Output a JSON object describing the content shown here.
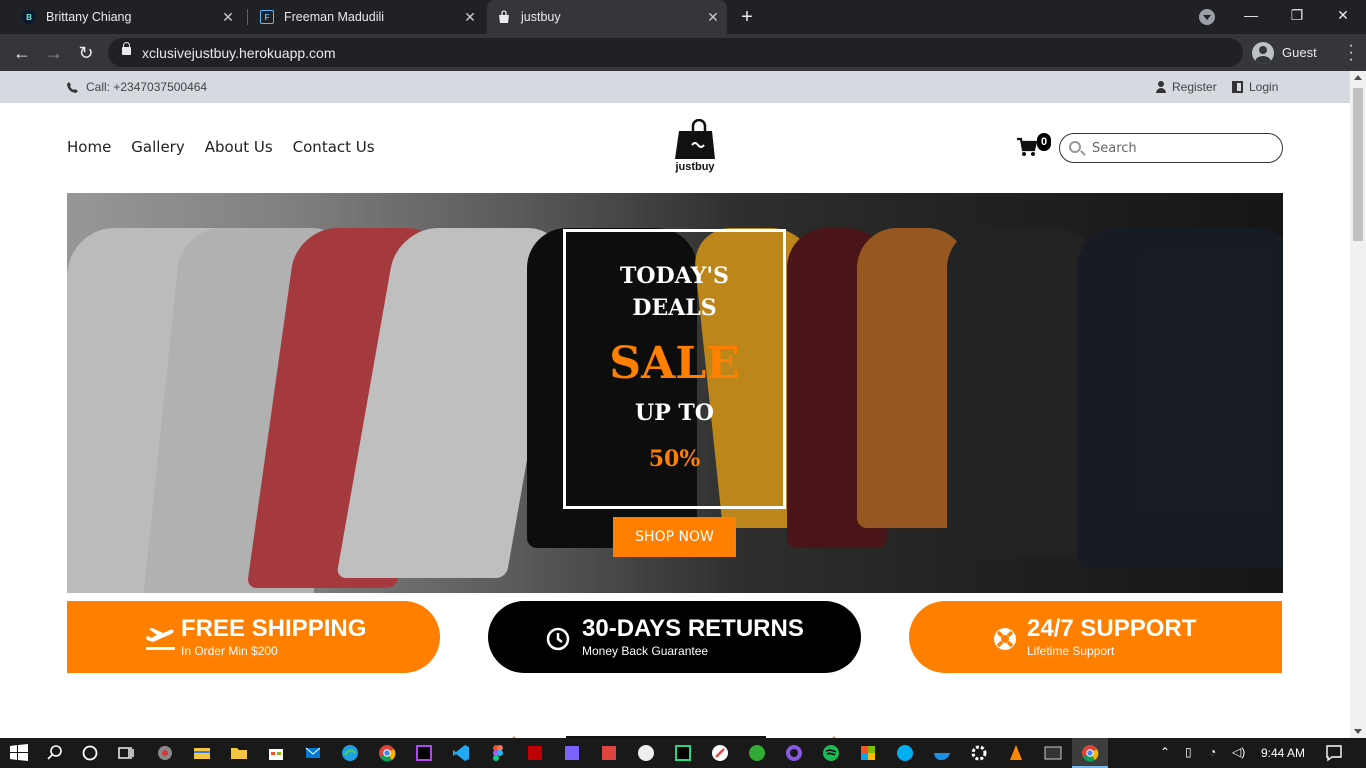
{
  "browser": {
    "tabs": [
      {
        "title": "Brittany Chiang",
        "favicon": "B"
      },
      {
        "title": "Freeman Madudili",
        "favicon": "F"
      },
      {
        "title": "justbuy",
        "favicon": "bag"
      }
    ],
    "url": "xclusivejustbuy.herokuapp.com",
    "profile": "Guest"
  },
  "topbar": {
    "call": "Call: +2347037500464",
    "register": "Register",
    "login": "Login"
  },
  "nav": {
    "items": [
      "Home",
      "Gallery",
      "About Us",
      "Contact Us"
    ]
  },
  "logo": {
    "text": "justbuy"
  },
  "cart": {
    "count": "0"
  },
  "search": {
    "placeholder": "Search"
  },
  "hero": {
    "deal_line1": "TODAY'S",
    "deal_line2": "DEALS",
    "sale": "SALE",
    "upto": "UP TO",
    "percent": "50%",
    "cta": "SHOP NOW"
  },
  "features": [
    {
      "title": "FREE SHIPPING",
      "subtitle": "In Order Min $200",
      "icon": "plane-icon"
    },
    {
      "title": "30-DAYS RETURNS",
      "subtitle": "Money Back Guarantee",
      "icon": "clock-icon"
    },
    {
      "title": "24/7 SUPPORT",
      "subtitle": "Lifetime Support",
      "icon": "lifebuoy-icon"
    }
  ],
  "taskbar": {
    "time": "9:44 AM"
  },
  "colors": {
    "accent": "#ff7f00",
    "dark": "#000000",
    "topbar": "#d6d9e0"
  }
}
